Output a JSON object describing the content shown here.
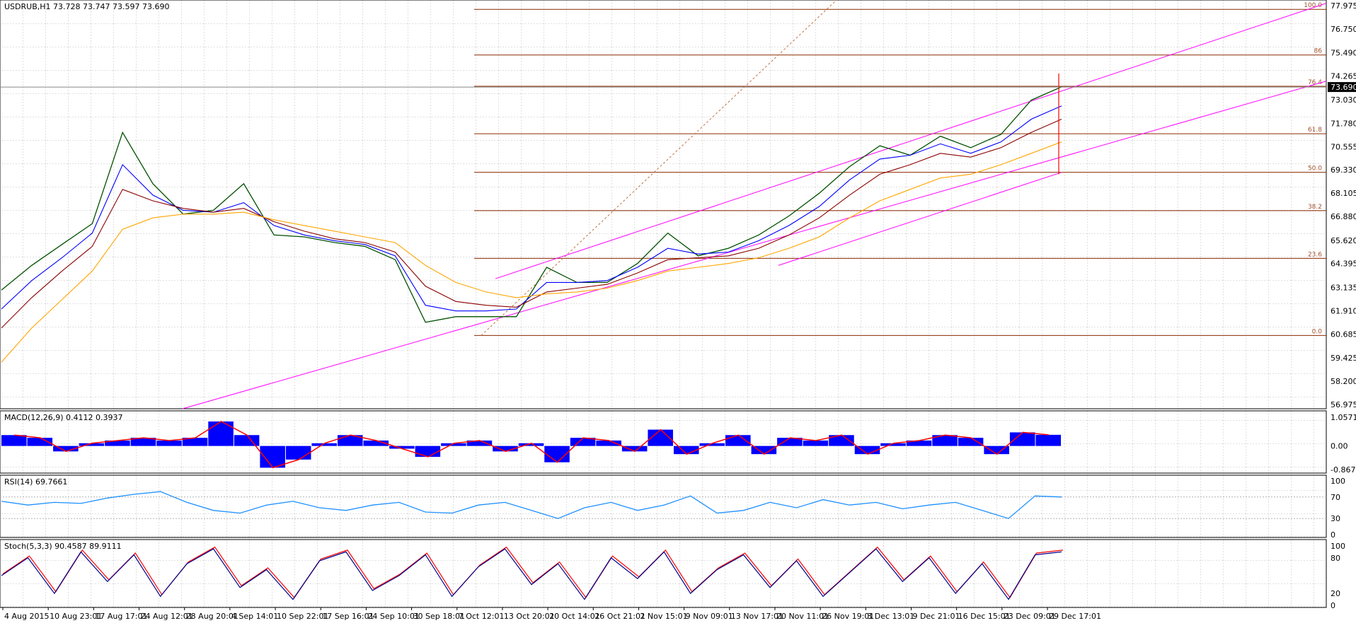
{
  "chart_data": [
    {
      "type": "line",
      "pane": "price",
      "title": "USDRUB,H1  73.728 73.747 73.597 73.690",
      "symbol": "USDRUB",
      "timeframe": "H1",
      "ohlc": {
        "open": 73.728,
        "high": 73.747,
        "low": 73.597,
        "close": 73.69
      },
      "ylim": [
        56.975,
        77.975
      ],
      "yticks": [
        "77.975",
        "76.750",
        "75.490",
        "74.265",
        "73.690",
        "73.030",
        "71.780",
        "70.555",
        "69.330",
        "68.105",
        "66.880",
        "65.620",
        "64.395",
        "63.135",
        "61.910",
        "60.685",
        "59.425",
        "58.200",
        "56.975"
      ],
      "current_price_label": "73.690",
      "x": [
        "4 Aug 2015",
        "10 Aug 23:01",
        "17 Aug 17:01",
        "24 Aug 12:01",
        "28 Aug 20:01",
        "4 Sep 14:01",
        "10 Sep 22:01",
        "17 Sep 16:01",
        "24 Sep 10:01",
        "30 Sep 18:01",
        "7 Oct 12:01",
        "13 Oct 20:01",
        "20 Oct 14:01",
        "26 Oct 21:01",
        "2 Nov 15:01",
        "9 Nov 09:01",
        "13 Nov 17:01",
        "20 Nov 11:01",
        "26 Nov 19:01",
        "3 Dec 13:01",
        "9 Dec 21:01",
        "16 Dec 15:01",
        "23 Dec 09:01",
        "29 Dec 17:01"
      ],
      "series": [
        {
          "values": [
            63.0,
            64.3,
            65.4,
            66.5,
            71.3,
            68.6,
            67.0,
            67.2,
            68.6,
            65.9,
            65.8,
            65.5,
            65.3,
            64.6,
            61.3,
            61.6,
            61.6,
            61.6,
            64.2,
            63.4,
            63.4,
            64.4,
            66.0,
            64.8,
            65.2,
            65.9,
            66.9,
            68.1,
            69.5,
            70.6,
            70.1,
            71.1,
            70.5,
            71.2,
            73.0,
            73.7
          ]
        },
        {
          "values": [
            62.0,
            63.5,
            64.7,
            66.0,
            69.6,
            68.0,
            67.2,
            67.1,
            67.6,
            66.4,
            65.9,
            65.6,
            65.4,
            64.8,
            62.2,
            61.9,
            61.9,
            62.0,
            63.4,
            63.4,
            63.5,
            64.2,
            65.2,
            64.9,
            65.0,
            65.6,
            66.4,
            67.4,
            68.8,
            69.9,
            70.1,
            70.7,
            70.2,
            70.8,
            72.0,
            72.7
          ]
        },
        {
          "values": [
            61.0,
            62.6,
            64.0,
            65.3,
            68.3,
            67.7,
            67.3,
            67.1,
            67.3,
            66.6,
            66.1,
            65.7,
            65.5,
            65.0,
            63.2,
            62.4,
            62.2,
            62.1,
            62.9,
            63.1,
            63.3,
            63.9,
            64.6,
            64.7,
            64.8,
            65.2,
            65.9,
            66.8,
            68.0,
            69.1,
            69.6,
            70.2,
            70.0,
            70.5,
            71.3,
            72.0
          ]
        },
        {
          "values": [
            59.2,
            61.0,
            62.5,
            64.0,
            66.2,
            66.8,
            67.0,
            67.0,
            67.1,
            66.7,
            66.4,
            66.1,
            65.8,
            65.5,
            64.3,
            63.4,
            62.9,
            62.6,
            62.8,
            62.9,
            63.1,
            63.5,
            64.0,
            64.2,
            64.4,
            64.7,
            65.2,
            65.8,
            66.8,
            67.7,
            68.3,
            68.9,
            69.1,
            69.6,
            70.2,
            70.8
          ]
        }
      ],
      "fibonacci": [
        {
          "level": "100.0",
          "price": 77.78
        },
        {
          "level": "86",
          "price": 75.38
        },
        {
          "level": "76.4",
          "price": 73.73
        },
        {
          "level": "61.8",
          "price": 71.23
        },
        {
          "level": "50.0",
          "price": 69.2
        },
        {
          "level": "38.2",
          "price": 67.18
        },
        {
          "level": "23.6",
          "price": 64.67
        },
        {
          "level": "0.0",
          "price": 60.61
        }
      ]
    },
    {
      "type": "bar",
      "pane": "macd",
      "title": "MACD(12,26,9) 0.4112 0.3937",
      "ylim": [
        -0.8673,
        1.0571
      ],
      "yticks": [
        "1.0571",
        "0.00",
        "-0.8673"
      ],
      "values": [
        0.4,
        0.3,
        -0.2,
        0.1,
        0.2,
        0.3,
        0.2,
        0.3,
        0.9,
        0.4,
        -0.8,
        -0.5,
        0.1,
        0.4,
        0.2,
        -0.1,
        -0.4,
        0.1,
        0.2,
        -0.2,
        0.1,
        -0.6,
        0.3,
        0.2,
        -0.2,
        0.6,
        -0.3,
        0.1,
        0.4,
        -0.3,
        0.3,
        0.2,
        0.4,
        -0.3,
        0.1,
        0.2,
        0.4,
        0.3,
        -0.3,
        0.5,
        0.41
      ]
    },
    {
      "type": "line",
      "pane": "rsi",
      "title": "RSI(14) 69.7661",
      "ylim": [
        0,
        100
      ],
      "yticks": [
        "100",
        "70",
        "30",
        "0"
      ],
      "values": [
        62,
        55,
        60,
        58,
        68,
        75,
        80,
        60,
        45,
        40,
        55,
        62,
        50,
        45,
        55,
        60,
        42,
        40,
        55,
        60,
        45,
        30,
        50,
        60,
        45,
        55,
        72,
        40,
        45,
        60,
        50,
        65,
        55,
        60,
        48,
        55,
        60,
        45,
        30,
        72,
        70
      ]
    },
    {
      "type": "line",
      "pane": "stochastic",
      "title": "Stoch(5,3,3) 90.4587 89.9111",
      "ylim": [
        0,
        100
      ],
      "yticks": [
        "100",
        "80",
        "20",
        "0"
      ],
      "values": [
        50,
        80,
        20,
        90,
        40,
        85,
        15,
        70,
        95,
        30,
        60,
        10,
        75,
        90,
        25,
        50,
        85,
        15,
        65,
        95,
        35,
        70,
        10,
        80,
        45,
        90,
        20,
        60,
        85,
        30,
        75,
        15,
        55,
        95,
        40,
        80,
        20,
        70,
        10,
        85,
        90
      ]
    }
  ]
}
